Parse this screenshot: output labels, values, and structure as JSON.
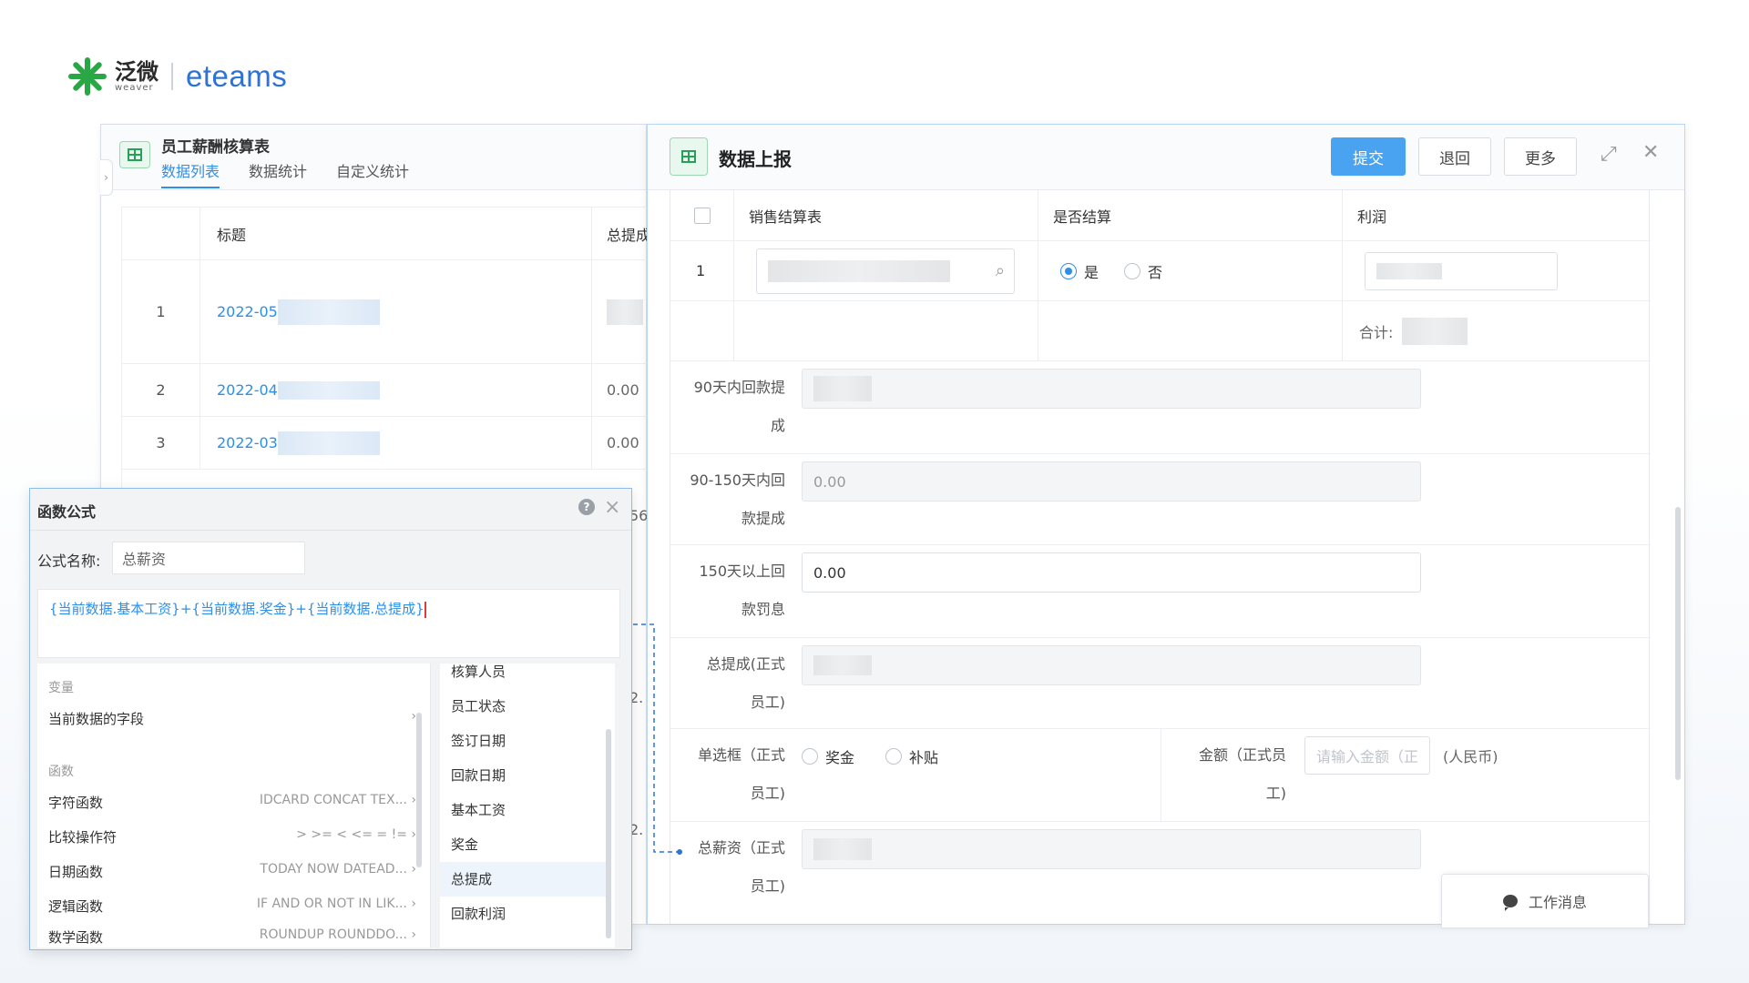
{
  "logo": {
    "cn": "泛微",
    "en": "weaver",
    "product": "eteams"
  },
  "list_window": {
    "title": "员工薪酬核算表",
    "tabs": [
      {
        "label": "数据列表",
        "active": true
      },
      {
        "label": "数据统计",
        "active": false
      },
      {
        "label": "自定义统计",
        "active": false
      }
    ],
    "columns": [
      "标题",
      "总提成"
    ],
    "rows": [
      {
        "num": "1",
        "title": "2022-05",
        "total": ""
      },
      {
        "num": "2",
        "title": "2022-04",
        "total": "0.00"
      },
      {
        "num": "3",
        "title": "2022-03",
        "total": "0.00"
      }
    ],
    "partial_values": [
      "56",
      "2.",
      "2."
    ]
  },
  "form_window": {
    "title": "数据上报",
    "buttons": {
      "submit": "提交",
      "back": "退回",
      "more": "更多"
    },
    "sub_table": {
      "columns": [
        "销售结算表",
        "是否结算",
        "利润"
      ],
      "row_num": "1",
      "radio_yes": "是",
      "radio_no": "否",
      "sum_label": "合计:"
    },
    "fields": [
      {
        "label_line1": "90天内回款提",
        "label_line2": "成",
        "value": "",
        "disabled": true
      },
      {
        "label_line1": "90-150天内回",
        "label_line2": "款提成",
        "value": "0.00",
        "disabled": true
      },
      {
        "label_line1": "150天以上回",
        "label_line2": "款罚息",
        "value": "0.00",
        "disabled": false
      },
      {
        "label_line1": "总提成(正式",
        "label_line2": "员工)",
        "value": "",
        "disabled": true
      }
    ],
    "radio_field": {
      "label_line1": "单选框（正式",
      "label_line2": "员工)",
      "options": [
        "奖金",
        "补贴"
      ]
    },
    "amount_field": {
      "label_line1": "金额（正式员",
      "label_line2": "工)",
      "placeholder": "请输入金额（正",
      "unit": "(人民币)"
    },
    "salary_field": {
      "label_line1": "总薪资（正式",
      "label_line2": "员工)"
    }
  },
  "formula_dialog": {
    "title": "函数公式",
    "name_label": "公式名称:",
    "name_value": "总薪资",
    "formula": "{当前数据.基本工资}+{当前数据.奖金}+{当前数据.总提成}",
    "sections": {
      "variables": "变量",
      "functions": "函数"
    },
    "variable_item": "当前数据的字段",
    "function_items": [
      {
        "name": "字符函数",
        "hint": "IDCARD CONCAT TEX..."
      },
      {
        "name": "比较操作符",
        "hint": "> >= < <= = !="
      },
      {
        "name": "日期函数",
        "hint": "TODAY NOW DATEAD..."
      },
      {
        "name": "逻辑函数",
        "hint": "IF AND OR NOT IN LIK..."
      },
      {
        "name": "数学函数",
        "hint": "ROUNDUP ROUNDDO..."
      }
    ],
    "fields": [
      "核算人员",
      "员工状态",
      "签订日期",
      "回款日期",
      "基本工资",
      "奖金",
      "总提成",
      "回款利润"
    ],
    "selected_field": "总提成"
  },
  "message_button": {
    "label": "工作消息"
  },
  "colors": {
    "primary": "#4aa3f0",
    "link": "#2e8fe6",
    "brand_green": "#2aa745",
    "brand_blue": "#2e73d4"
  }
}
